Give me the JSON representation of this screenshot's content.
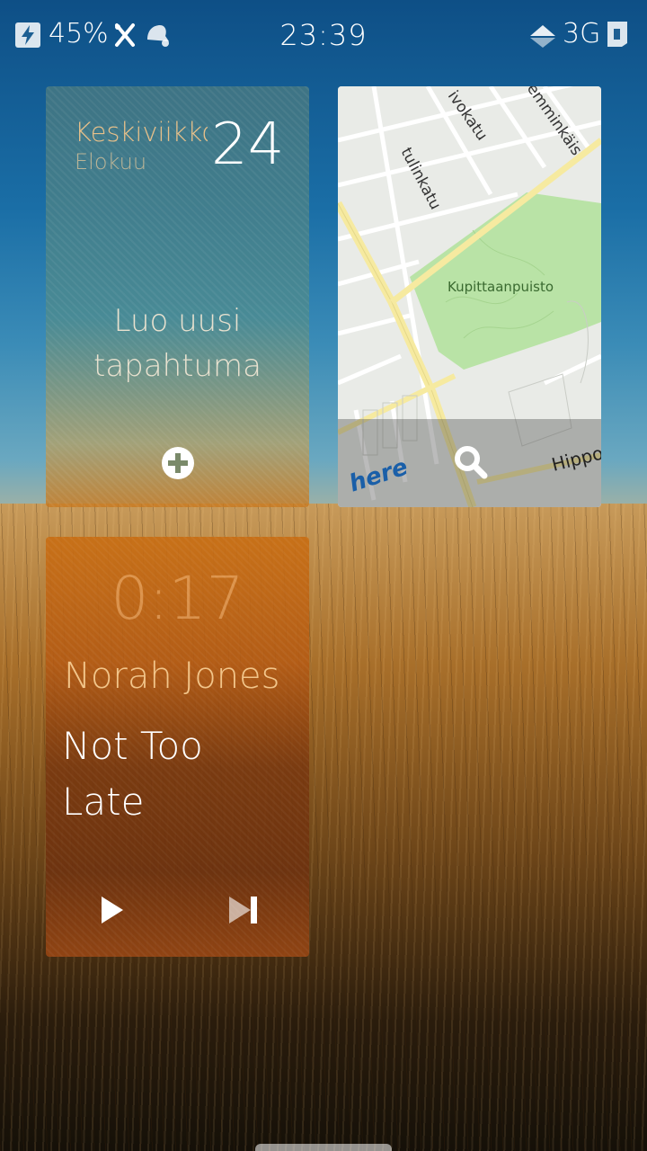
{
  "status_bar": {
    "battery_percent": "45%",
    "time": "23:39",
    "network": "3G",
    "icons": [
      "charging-icon",
      "flight-mode-icon",
      "notification-bell-icon",
      "signal-icon",
      "sim-icon"
    ]
  },
  "calendar_tile": {
    "weekday": "Keskiviikko",
    "month": "Elokuu",
    "day": "24",
    "new_event_label": "Luo uusi tapahtuma",
    "add_icon": "plus-circle-icon"
  },
  "map_tile": {
    "park_label": "Kupittaanpuisto",
    "street_labels": [
      "tulinkatu",
      "ivokatu",
      "emminkäis",
      "Hippo"
    ],
    "provider_logo": "here",
    "search_icon": "search-icon"
  },
  "music_tile": {
    "elapsed": "0:17",
    "artist": "Norah Jones",
    "track_title": "Not Too Late",
    "controls": [
      "play-icon",
      "next-track-icon"
    ]
  },
  "colors": {
    "calendar_accent": "#e7c08a",
    "map_park": "#b9e3a6",
    "map_road": "#f6eaa0",
    "music_tile": "#b85a14"
  }
}
